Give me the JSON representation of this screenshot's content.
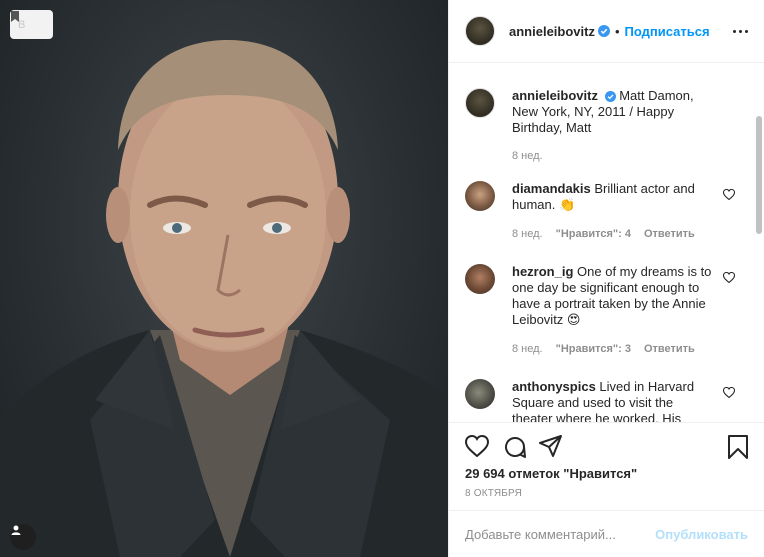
{
  "photo": {
    "save_hint": "B"
  },
  "post": {
    "author": "annieleibovitz",
    "follow_label": "Подписаться",
    "separator": "•",
    "caption_author": "annieleibovitz",
    "caption_text": "Matt Damon, New York, NY, 2011 / Happy Birthday, Matt",
    "caption_time": "8 нед.",
    "likes": "29 694 отметок \"Нравится\"",
    "date": "8 ОКТЯБРЯ"
  },
  "comments": [
    {
      "user": "diamandakis",
      "text": "Brilliant actor and human. 👏",
      "time": "8 нед.",
      "likes": "\"Нравится\": 4",
      "reply": "Ответить"
    },
    {
      "user": "hezron_ig",
      "text": "One of my dreams is to one day be significant enough to have a portrait taken by the Annie Leibovitz 😍",
      "time": "8 нед.",
      "likes": "\"Нравится\": 3",
      "reply": "Ответить"
    },
    {
      "user": "anthonyspics",
      "text": "Lived in Harvard Square and used to visit the theater where he worked. His",
      "time": "",
      "likes": "",
      "reply": ""
    }
  ],
  "add_comment": {
    "placeholder": "Добавьте комментарий...",
    "publish_label": "Опубликовать"
  },
  "colors": {
    "accent": "#0095f6",
    "publish_disabled": "#b2dffc",
    "muted": "#8e8e8e",
    "text": "#262626"
  },
  "icons": [
    "bookmark-icon",
    "user-tag-icon",
    "verified-icon",
    "more-icon",
    "heart-icon",
    "comment-icon",
    "share-icon",
    "save-icon"
  ]
}
